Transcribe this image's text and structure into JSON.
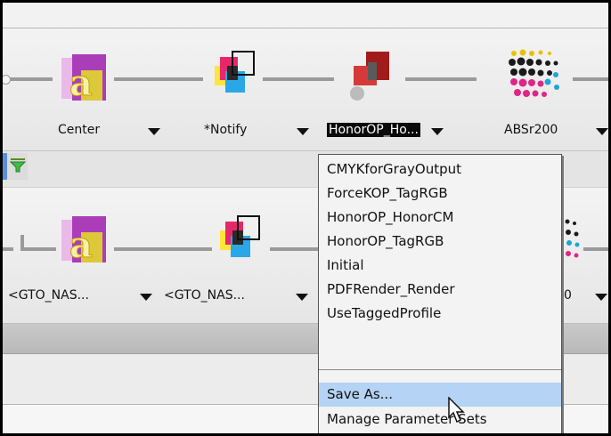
{
  "pipeline_top": {
    "nodes": [
      {
        "label": "Center",
        "icon": "text-a-icon"
      },
      {
        "label": "*Notify",
        "icon": "cmyk-overlay-icon"
      },
      {
        "label": "HonorOP_Ho...",
        "icon": "overprint-shapes-icon",
        "selected": true
      },
      {
        "label": "ABSr200",
        "icon": "halftone-dots-icon"
      }
    ]
  },
  "toolbar": {
    "filter_icon": "filter-funnel-icon"
  },
  "pipeline_bottom": {
    "nodes": [
      {
        "label": "<GTO_NAS...",
        "icon": "text-a-icon"
      },
      {
        "label": "<GTO_NAS...",
        "icon": "cmyk-overlay-icon"
      },
      {
        "label": "0",
        "icon": "halftone-dots-icon"
      }
    ]
  },
  "menu": {
    "items": [
      "CMYKforGrayOutput",
      "ForceKOP_TagRGB",
      "HonorOP_HonorCM",
      "HonorOP_TagRGB",
      "Initial",
      "PDFRender_Render",
      "UseTaggedProfile"
    ],
    "save_as": "Save As...",
    "manage": "Manage Parameter Sets"
  },
  "colors": {
    "menu_highlight": "#b5d3f4",
    "selection_bg": "#0a0a0a"
  }
}
